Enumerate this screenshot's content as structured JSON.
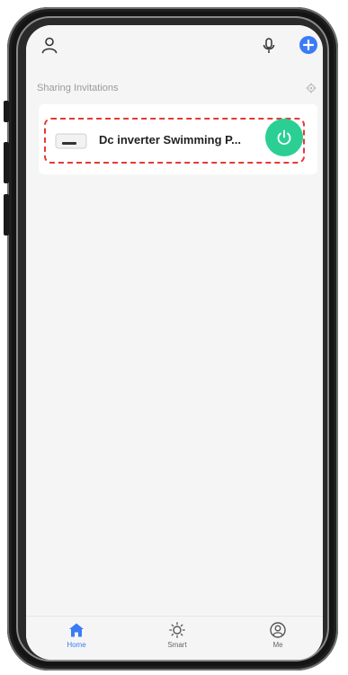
{
  "colors": {
    "accent": "#3b7cf5",
    "power": "#2ccf93",
    "highlight": "#e53935"
  },
  "header": {
    "left_icon": "user-icon",
    "right_icons": [
      "microphone-icon",
      "add-circle-icon"
    ]
  },
  "sharing": {
    "section_label": "Sharing Invitations",
    "settings_icon": "gear-icon"
  },
  "device": {
    "name": "Dc inverter Swimming P...",
    "icon": "heat-pump-icon",
    "power_icon": "power-icon"
  },
  "tabs": [
    {
      "label": "Home",
      "icon": "home-icon",
      "active": true
    },
    {
      "label": "Smart",
      "icon": "sun-icon",
      "active": false
    },
    {
      "label": "Me",
      "icon": "profile-circle-icon",
      "active": false
    }
  ]
}
